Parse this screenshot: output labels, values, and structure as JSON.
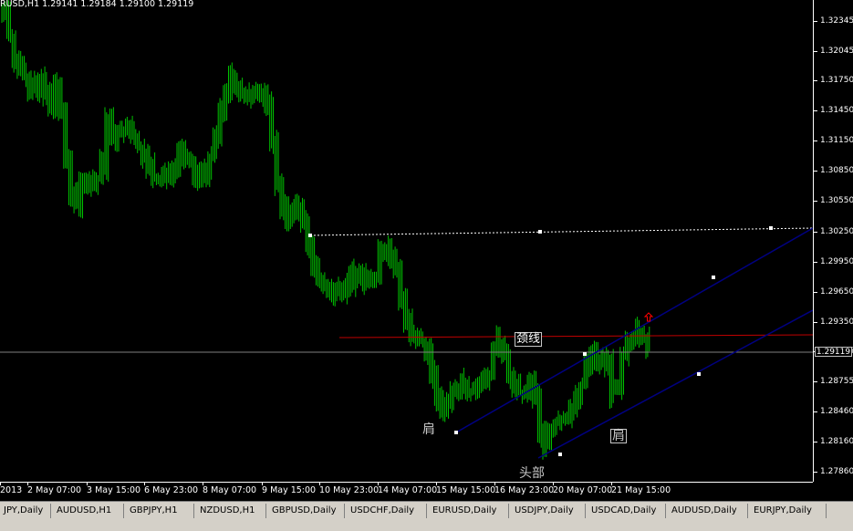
{
  "header": {
    "symbol_info": "RUSD,H1  1.29141 1.29184 1.29100 1.29119"
  },
  "price_axis": {
    "ticks": [
      "1.32345",
      "1.32045",
      "1.31750",
      "1.31450",
      "1.31150",
      "1.30850",
      "1.30550",
      "1.30250",
      "1.29950",
      "1.29650",
      "1.29350",
      "1.29055",
      "1.28755",
      "1.28460",
      "1.28160",
      "1.27860"
    ],
    "tick_values": [
      1.32345,
      1.32045,
      1.3175,
      1.3145,
      1.3115,
      1.3085,
      1.3055,
      1.3025,
      1.2995,
      1.2965,
      1.2935,
      1.29055,
      1.28755,
      1.2846,
      1.2816,
      1.2786
    ],
    "current_price": "1.29119"
  },
  "time_axis": {
    "labels": [
      "2013",
      "2 May 07:00",
      "3 May 15:00",
      "6 May 23:00",
      "8 May 07:00",
      "9 May 15:00",
      "10 May 23:00",
      "14 May 07:00",
      "15 May 15:00",
      "16 May 23:00",
      "20 May 07:00",
      "21 May 15:00"
    ]
  },
  "annotations": {
    "neckline": "颈线",
    "left_shoulder": "肩",
    "head": "头部",
    "right_shoulder": "肩"
  },
  "tabs": [
    "JPY,Daily",
    "AUDUSD,H1",
    "GBPJPY,H1",
    "NZDUSD,H1",
    "GBPUSD,Daily",
    "USDCHF,Daily",
    "EURUSD,Daily",
    "USDJPY,Daily",
    "USDCAD,Daily",
    "AUDUSD,Daily",
    "EURJPY,Daily"
  ],
  "colors": {
    "background": "#000000",
    "candle": "#00c000",
    "neckline": "#c00000",
    "channel": "#000080",
    "resistance": "#ffffff",
    "arrow": "#ff0000",
    "bid_line": "#808080"
  },
  "chart_data": {
    "type": "line",
    "series": [
      {
        "values": [
          1.3245,
          1.3218,
          1.3198,
          1.319,
          1.3176,
          1.317,
          1.3165,
          1.3178,
          1.316,
          1.315,
          1.3172,
          1.314,
          1.3095,
          1.306,
          1.305,
          1.3068,
          1.3075,
          1.3072,
          1.308,
          1.309,
          1.314,
          1.312,
          1.3128,
          1.3125,
          1.313,
          1.312,
          1.311,
          1.31,
          1.309,
          1.3078,
          1.308,
          1.3078,
          1.3082,
          1.3085,
          1.31,
          1.3095,
          1.3092,
          1.308,
          1.3082,
          1.3082,
          1.31,
          1.312,
          1.3148,
          1.3165,
          1.318,
          1.317,
          1.3165,
          1.3162,
          1.3165,
          1.3162,
          1.316,
          1.3155,
          1.3115,
          1.307,
          1.305,
          1.304,
          1.3045,
          1.305,
          1.303,
          1.301,
          1.299,
          1.2975,
          1.297,
          1.2965,
          1.2968,
          1.297,
          1.2962,
          1.2975,
          1.2982,
          1.2985,
          1.2978,
          1.2975,
          1.298,
          1.3005,
          1.301,
          1.2995,
          1.299,
          1.296,
          1.294,
          1.2925,
          1.292,
          1.2915,
          1.2905,
          1.288,
          1.286,
          1.285,
          1.2855,
          1.2865,
          1.287,
          1.2872,
          1.2868,
          1.2865,
          1.2872,
          1.2875,
          1.288,
          1.2905,
          1.2915,
          1.29,
          1.2882,
          1.2872,
          1.2865,
          1.2862,
          1.2872,
          1.286,
          1.2825,
          1.2815,
          1.2828,
          1.2835,
          1.2838,
          1.284,
          1.285,
          1.286,
          1.2872,
          1.289,
          1.2902,
          1.2892,
          1.289,
          1.2895,
          1.2865,
          1.287,
          1.29,
          1.2918,
          1.292,
          1.2925,
          1.292,
          1.2912
        ]
      }
    ],
    "annotation_lines": {
      "resistance": [
        1.303,
        1.3038
      ],
      "neckline": [
        1.293,
        1.293
      ],
      "channel_upper": [
        1.2846,
        1.3025
      ],
      "channel_lower": [
        1.2805,
        1.2965
      ]
    },
    "ylim": [
      1.2776,
      1.3255
    ],
    "grid": false
  }
}
